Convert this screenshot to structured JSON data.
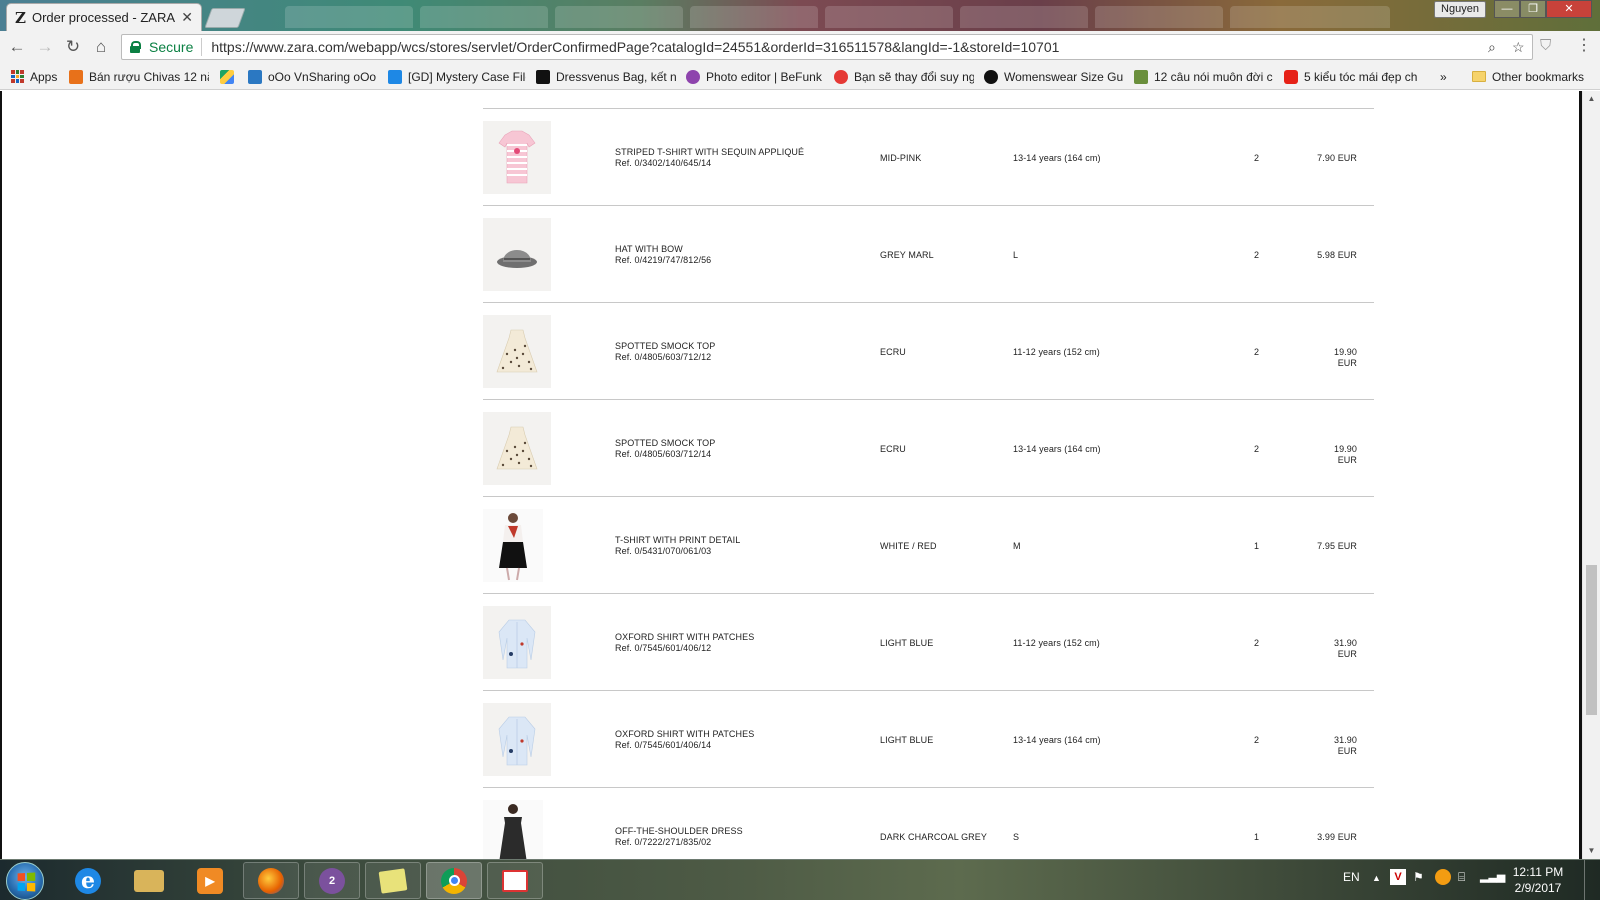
{
  "browser": {
    "tab_title": "Order processed - ZARA",
    "tab_favicon": "Z",
    "profile_name": "Nguyen",
    "secure_label": "Secure",
    "url": "https://www.zara.com/webapp/wcs/stores/servlet/OrderConfirmedPage?catalogId=24551&orderId=316511578&langId=-1&storeId=10701"
  },
  "bookmarks": {
    "apps_label": "Apps",
    "items": [
      {
        "label": "Bán rượu Chivas 12 nă",
        "icon_color": "#e8711a"
      },
      {
        "label": "",
        "icon_color": "#1fa463"
      },
      {
        "label": "oOo VnSharing oOo",
        "icon_color": "#2b78c2"
      },
      {
        "label": "[GD] Mystery Case File",
        "icon_color": "#1e88e5"
      },
      {
        "label": "Dressvenus Bag, kết n",
        "icon_color": "#111111"
      },
      {
        "label": "Photo editor | BeFunk",
        "icon_color": "#8e44ad"
      },
      {
        "label": "Bạn sẽ thay đổi suy ng",
        "icon_color": "#e53935"
      },
      {
        "label": "Womenswear Size Gu",
        "icon_color": "#111111"
      },
      {
        "label": "12 câu nói muôn đời c",
        "icon_color": "#6a8f3c"
      },
      {
        "label": "5 kiểu tóc mái đẹp ch",
        "icon_color": "#e62117"
      }
    ],
    "overflow_label": "»",
    "other_label": "Other bookmarks"
  },
  "order_items": [
    {
      "name": "STRIPED T-SHIRT WITH SEQUIN APPLIQUÉ",
      "ref": "Ref. 0/3402/140/645/14",
      "color": "MID-PINK",
      "size": "13-14 years (164 cm)",
      "qty": "2",
      "price": "7.90 EUR",
      "thumb": "pink-tshirt"
    },
    {
      "name": "HAT WITH BOW",
      "ref": "Ref. 0/4219/747/812/56",
      "color": "GREY MARL",
      "size": "L",
      "qty": "2",
      "price": "5.98 EUR",
      "thumb": "grey-hat"
    },
    {
      "name": "SPOTTED SMOCK TOP",
      "ref": "Ref. 0/4805/603/712/12",
      "color": "ECRU",
      "size": "11-12 years (152 cm)",
      "qty": "2",
      "price": "19.90 EUR",
      "thumb": "smock-top"
    },
    {
      "name": "SPOTTED SMOCK TOP",
      "ref": "Ref. 0/4805/603/712/14",
      "color": "ECRU",
      "size": "13-14 years (164 cm)",
      "qty": "2",
      "price": "19.90 EUR",
      "thumb": "smock-top"
    },
    {
      "name": "T-SHIRT WITH PRINT DETAIL",
      "ref": "Ref. 0/5431/070/061/03",
      "color": "WHITE / RED",
      "size": "M",
      "qty": "1",
      "price": "7.95 EUR",
      "thumb": "model-tshirt"
    },
    {
      "name": "OXFORD SHIRT WITH PATCHES",
      "ref": "Ref. 0/7545/601/406/12",
      "color": "LIGHT BLUE",
      "size": "11-12 years (152 cm)",
      "qty": "2",
      "price": "31.90 EUR",
      "thumb": "blue-shirt"
    },
    {
      "name": "OXFORD SHIRT WITH PATCHES",
      "ref": "Ref. 0/7545/601/406/14",
      "color": "LIGHT BLUE",
      "size": "13-14 years (164 cm)",
      "qty": "2",
      "price": "31.90 EUR",
      "thumb": "blue-shirt"
    },
    {
      "name": "OFF-THE-SHOULDER DRESS",
      "ref": "Ref. 0/7222/271/835/02",
      "color": "DARK CHARCOAL GREY",
      "size": "S",
      "qty": "1",
      "price": "3.99 EUR",
      "thumb": "model-dress"
    }
  ],
  "taskbar": {
    "apps": [
      {
        "name": "internet-explorer",
        "glyph": "e",
        "color": "#1e88e5"
      },
      {
        "name": "file-explorer",
        "glyph": "",
        "color": "#d9b45a"
      },
      {
        "name": "media-player",
        "glyph": "▶",
        "color": "#f08a24"
      },
      {
        "name": "firefox",
        "glyph": "",
        "color": "#e66000"
      },
      {
        "name": "viber",
        "glyph": "2",
        "color": "#7b519d"
      },
      {
        "name": "sticky-notes",
        "glyph": "",
        "color": "#e8e27a"
      },
      {
        "name": "chrome",
        "glyph": "",
        "color": "#4285f4"
      },
      {
        "name": "snipping-tool",
        "glyph": "",
        "color": "#d33"
      }
    ],
    "language": "EN",
    "time": "12:11 PM",
    "date": "2/9/2017"
  }
}
